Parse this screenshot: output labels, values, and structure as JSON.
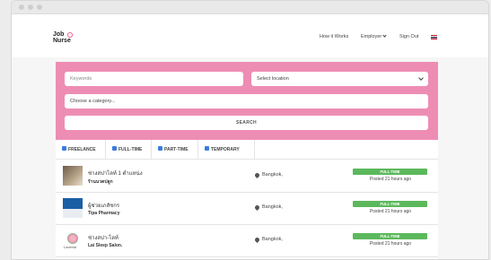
{
  "brand": {
    "line1": "Job",
    "line2": "Nurse"
  },
  "nav": {
    "how": "How it Works",
    "employer": "Employer",
    "signout": "Sign Out"
  },
  "search": {
    "keywords_placeholder": "Keywords",
    "location_value": "Select location",
    "category_value": "Choose a category...",
    "button": "SEARCH"
  },
  "filters": [
    {
      "label": "FREELANCE",
      "checked": true
    },
    {
      "label": "FULL-TIME",
      "checked": true
    },
    {
      "label": "PART-TIME",
      "checked": true
    },
    {
      "label": "TEMPORARY",
      "checked": true
    }
  ],
  "jobs": [
    {
      "title": "ช่างสปาไลท์ 1 ตำแหน่ง",
      "company": "ร้านนวดปลูก",
      "location": "Bangkok,",
      "type": "FULL-TIME",
      "posted": "Posted 21 hours ago"
    },
    {
      "title": "ผู้ช่วยเภสัชกร",
      "company": "Tipa Pharmacy",
      "location": "Bangkok,",
      "type": "FULL-TIME",
      "posted": "Posted 21 hours ago"
    },
    {
      "title": "ช่างสปา-ไลท์",
      "company": "Lai Sleep Salon.",
      "location": "Bangkok,",
      "type": "FULL-TIME",
      "posted": "Posted 21 hours ago",
      "logo_text": "Lavenid"
    }
  ],
  "colors": {
    "accent": "#ee8db4",
    "badge": "#5cb85c",
    "checkbox": "#3b7ddd"
  }
}
